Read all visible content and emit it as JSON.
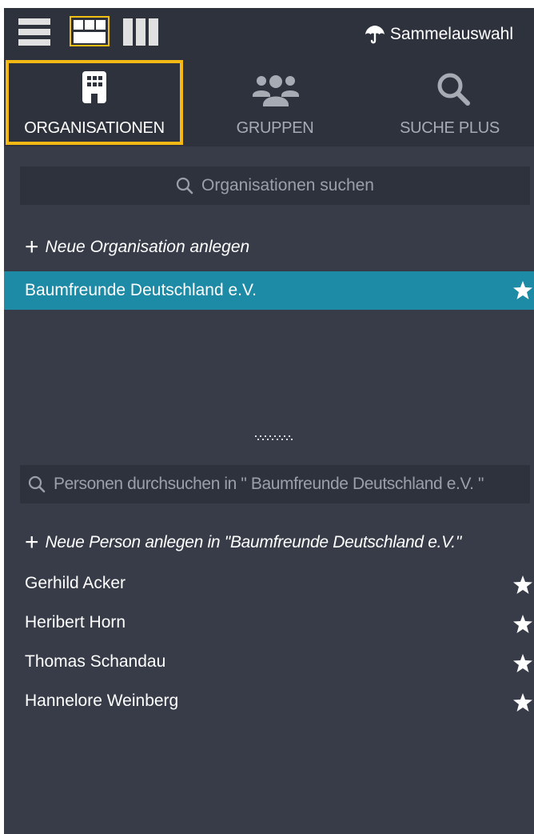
{
  "toolbar": {
    "views": [
      "list-view-icon",
      "tile-view-icon",
      "column-view-icon"
    ],
    "active_view": "tile-view-icon",
    "multiselect_label": "Sammelauswahl",
    "multiselect_icon": "umbrella-icon"
  },
  "tabs": [
    {
      "label": "ORGANISATIONEN",
      "icon": "building-icon",
      "active": true
    },
    {
      "label": "GRUPPEN",
      "icon": "people-icon",
      "active": false
    },
    {
      "label": "SUCHE PLUS",
      "icon": "search-icon",
      "active": false
    }
  ],
  "organisations": {
    "search_placeholder": "Organisationen suchen",
    "new_label": "Neue Organisation anlegen",
    "items": [
      {
        "name": "Baumfreunde Deutschland e.V.",
        "selected": true
      }
    ]
  },
  "persons": {
    "search_placeholder": "Personen durchsuchen in \" Baumfreunde Deutschland e.V. \"",
    "new_label": "Neue Person anlegen in \"Baumfreunde Deutschland e.V.\"",
    "items": [
      {
        "name": "Gerhild Acker"
      },
      {
        "name": "Heribert Horn"
      },
      {
        "name": "Thomas Schandau"
      },
      {
        "name": "Hannelore Weinberg"
      }
    ]
  },
  "colors": {
    "panel_bg": "#373c48",
    "header_bg": "#2e323c",
    "selected_row": "#1d8aa6",
    "active_tab_border": "#f5b915"
  }
}
